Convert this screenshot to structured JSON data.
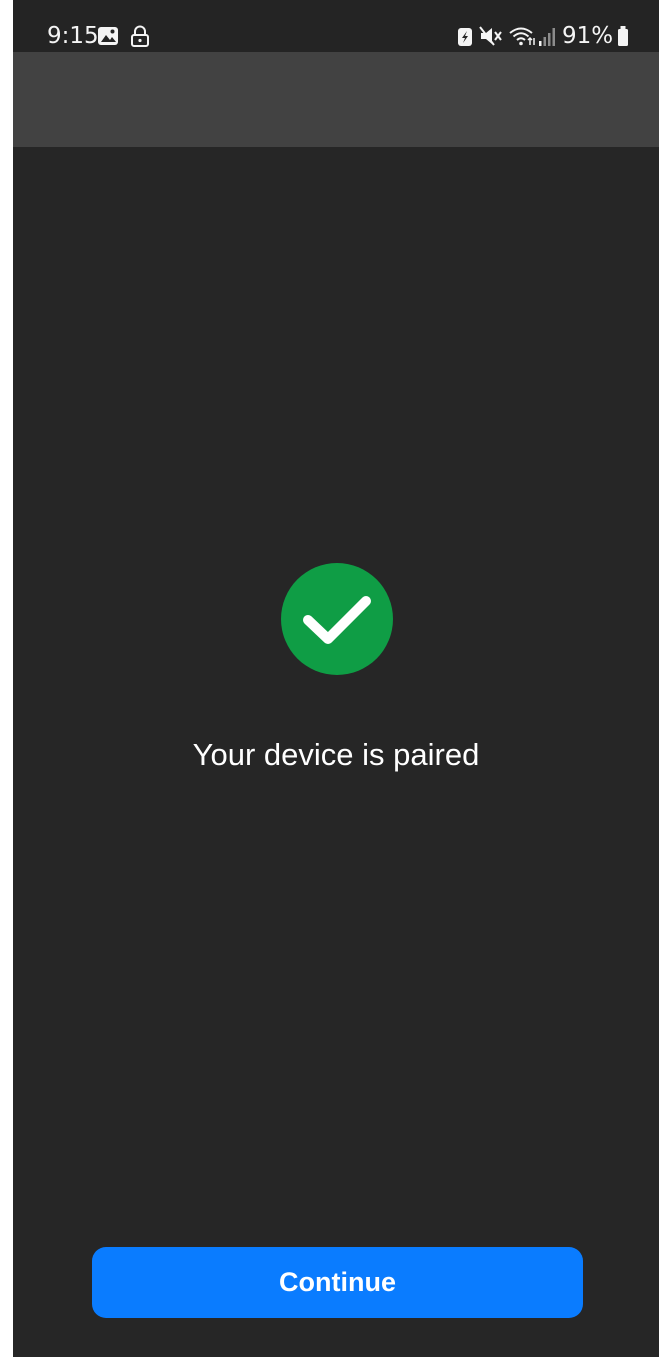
{
  "status_bar": {
    "time": "9:15",
    "battery_percent": "91%",
    "icons": [
      "gallery-icon",
      "lock-icon",
      "battery-saver-icon",
      "mute-icon",
      "wifi-icon",
      "signal-icon",
      "battery-icon"
    ]
  },
  "main": {
    "message": "Your device is paired",
    "success_color": "#0f9d45"
  },
  "footer": {
    "continue_label": "Continue",
    "button_color": "#0a7cff"
  }
}
